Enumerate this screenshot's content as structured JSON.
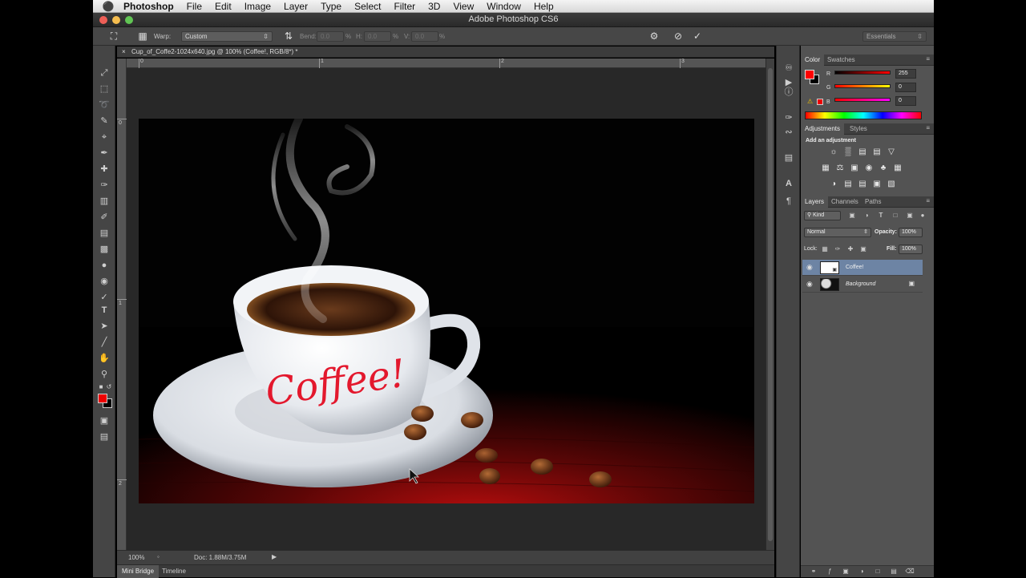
{
  "menubar": {
    "apple": "",
    "items": [
      "Photoshop",
      "File",
      "Edit",
      "Image",
      "Layer",
      "Type",
      "Select",
      "Filter",
      "3D",
      "View",
      "Window",
      "Help"
    ]
  },
  "window": {
    "title": "Adobe Photoshop CS6"
  },
  "options": {
    "warp_label": "Warp:",
    "warp_value": "Custom",
    "bend_label": "Bend:",
    "bend_value": "0.0",
    "bend_unit": "%",
    "h_label": "H:",
    "h_value": "0.0",
    "h_unit": "%",
    "v_label": "V:",
    "v_value": "0.0",
    "v_unit": "%",
    "workspace": "Essentials"
  },
  "document": {
    "tab_title": "Cup_of_Coffe2-1024x640.jpg @ 100% (Coffee!, RGB/8*) *",
    "close": "×",
    "ruler_h_labels": [
      "0",
      "1",
      "2",
      "3"
    ],
    "ruler_v_labels": [
      "0",
      "1",
      "2"
    ],
    "text_layer_content": "Coffee!"
  },
  "status": {
    "zoom": "100%",
    "doc_size": "Doc: 1.88M/3.75M"
  },
  "bottom_tabs": [
    "Mini Bridge",
    "Timeline"
  ],
  "color_panel": {
    "tabs": [
      "Color",
      "Swatches"
    ],
    "channels": [
      {
        "label": "R",
        "value": "255"
      },
      {
        "label": "G",
        "value": "0"
      },
      {
        "label": "B",
        "value": "0"
      }
    ],
    "foreground": "#ff0000",
    "background": "#000000"
  },
  "adjustments_panel": {
    "tabs": [
      "Adjustments",
      "Styles"
    ],
    "heading": "Add an adjustment"
  },
  "layers_panel": {
    "tabs": [
      "Layers",
      "Channels",
      "Paths"
    ],
    "filter": "Kind",
    "blend_mode": "Normal",
    "opacity_label": "Opacity:",
    "opacity_value": "100%",
    "lock_label": "Lock:",
    "fill_label": "Fill:",
    "fill_value": "100%",
    "layers": [
      {
        "name": "Coffee!",
        "selected": true,
        "locked": false
      },
      {
        "name": "Background",
        "selected": false,
        "locked": true
      }
    ]
  },
  "colors": {
    "accent_selected_layer": "#6d84a4",
    "foreground_swatch": "#e00000"
  }
}
